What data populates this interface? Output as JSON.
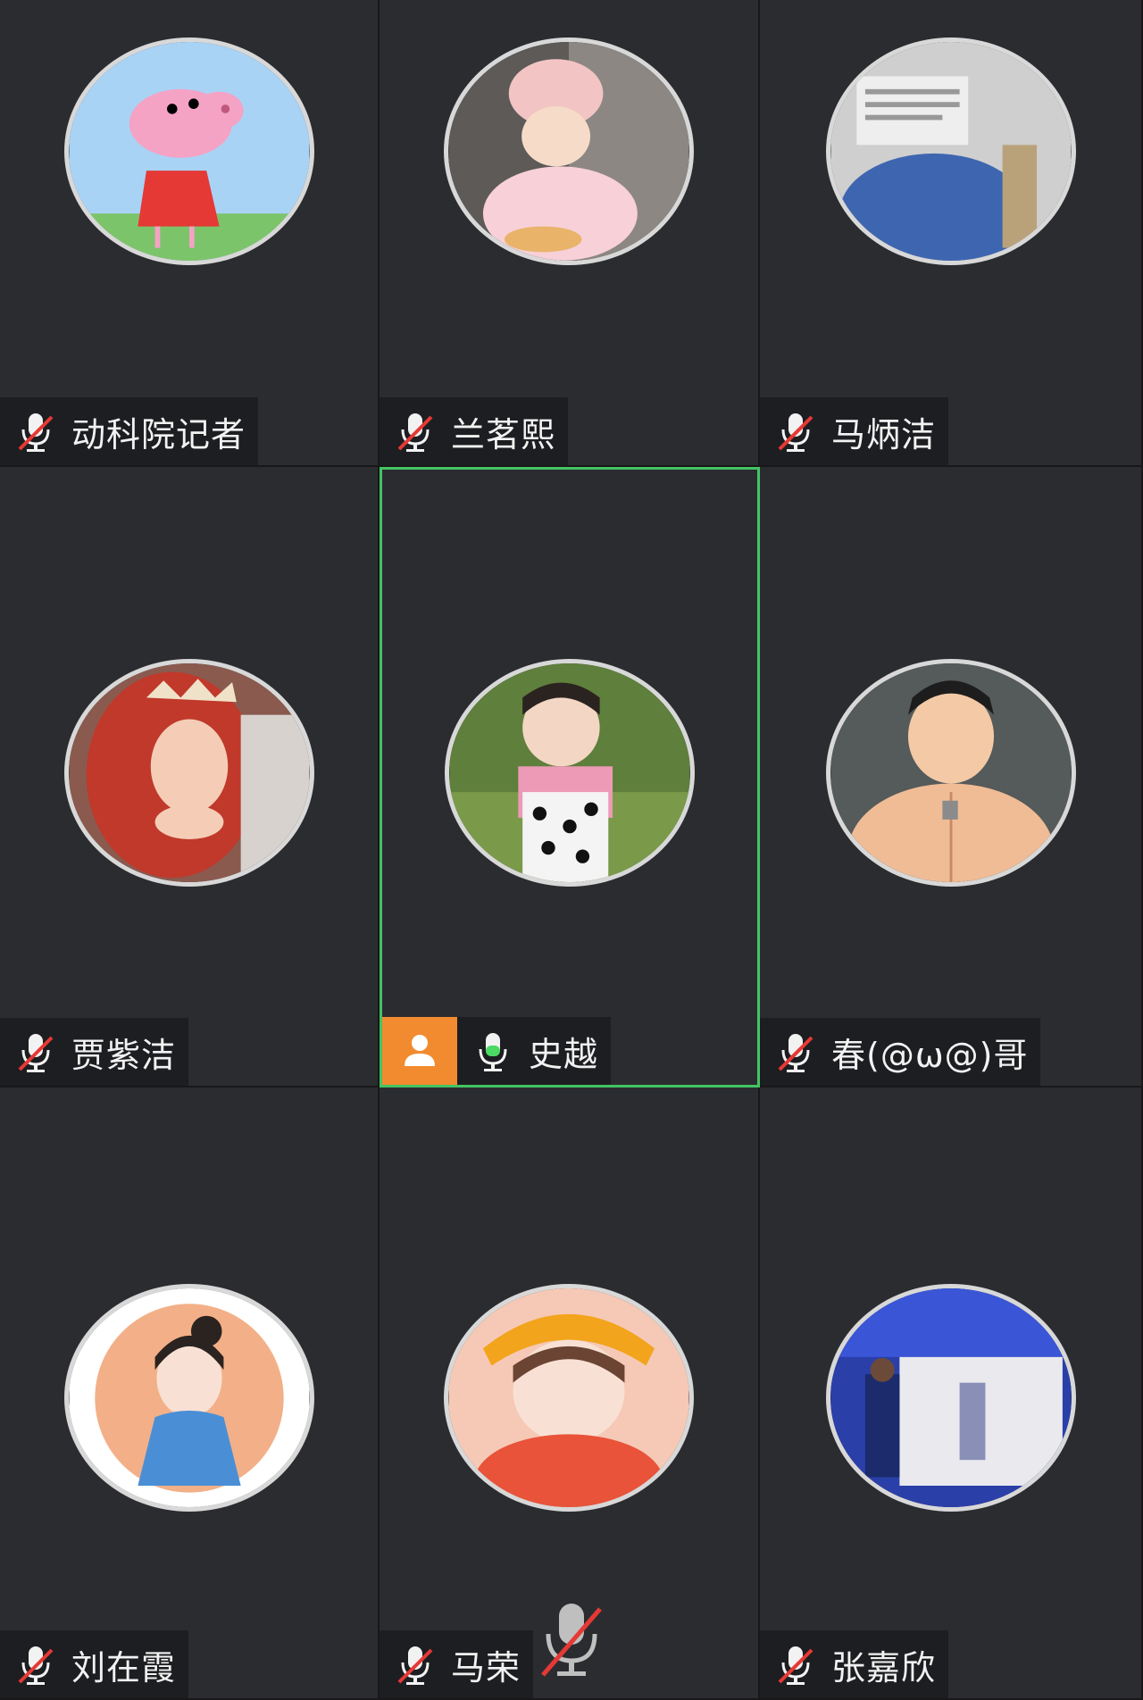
{
  "participants": [
    {
      "name": "动科院记者",
      "muted": true,
      "avatar": "peppa-pig-avatar"
    },
    {
      "name": "兰茗熙",
      "muted": true,
      "avatar": "girl-pink-hat-avatar"
    },
    {
      "name": "马炳洁",
      "muted": true,
      "avatar": "person-newspaper-avatar"
    },
    {
      "name": "贾紫洁",
      "muted": true,
      "avatar": "princess-red-hair-avatar"
    },
    {
      "name": "史越",
      "muted": false,
      "host": true,
      "speaking": true,
      "avatar": "toddler-polka-dot-avatar"
    },
    {
      "name": "春(@ω@)哥",
      "muted": true,
      "avatar": "cartoon-muscle-man-avatar"
    },
    {
      "name": "刘在霞",
      "muted": true,
      "avatar": "cartoon-girl-bun-avatar"
    },
    {
      "name": "马荣",
      "muted": true,
      "avatar": "cartoon-girl-tiger-hat-avatar"
    },
    {
      "name": "张嘉欣",
      "muted": true,
      "avatar": "basketball-poster-avatar"
    }
  ],
  "colors": {
    "speaking_border": "#43c463",
    "host_badge": "#f28b2f",
    "muted_slash": "#e53935",
    "mic_active": "#4cd964"
  },
  "icons": {
    "muted": "mic-muted-icon",
    "unmuted": "mic-on-icon",
    "host": "host-person-icon",
    "self_mute": "self-mic-muted-icon"
  }
}
